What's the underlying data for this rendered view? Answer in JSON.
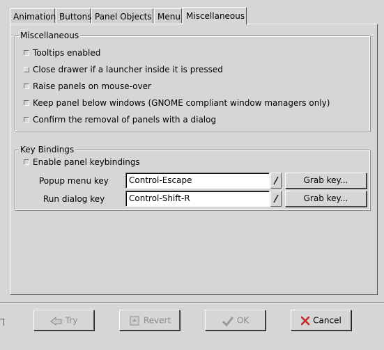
{
  "tabs": [
    {
      "label": "Animation"
    },
    {
      "label": "Buttons"
    },
    {
      "label": "Panel Objects"
    },
    {
      "label": "Menu"
    },
    {
      "label": "Miscellaneous"
    }
  ],
  "active_tab": "Miscellaneous",
  "misc_section": {
    "title": "Miscellaneous",
    "options": [
      {
        "label": "Tooltips enabled",
        "checked": false
      },
      {
        "label": "Close drawer if a launcher inside it is pressed",
        "checked": false
      },
      {
        "label": "Raise panels on mouse-over",
        "checked": false
      },
      {
        "label": "Keep panel below windows (GNOME compliant window managers only)",
        "checked": false
      },
      {
        "label": "Confirm the removal of panels with a dialog",
        "checked": false
      }
    ]
  },
  "keybindings": {
    "title": "Key Bindings",
    "enable_label": "Enable panel keybindings",
    "enable_checked": false,
    "popup_label": "Popup menu key",
    "popup_value": "Control-Escape",
    "run_label": "Run dialog key",
    "run_value": "Control-Shift-R",
    "slash_glyph": "/",
    "grab_label": "Grab key..."
  },
  "buttons": {
    "try": "Try",
    "revert": "Revert",
    "ok": "OK",
    "cancel": "Cancel"
  },
  "colors": {
    "background": "#d6d6d6",
    "cancel_icon": "#c62828",
    "disabled_text": "#8c8c8c"
  }
}
